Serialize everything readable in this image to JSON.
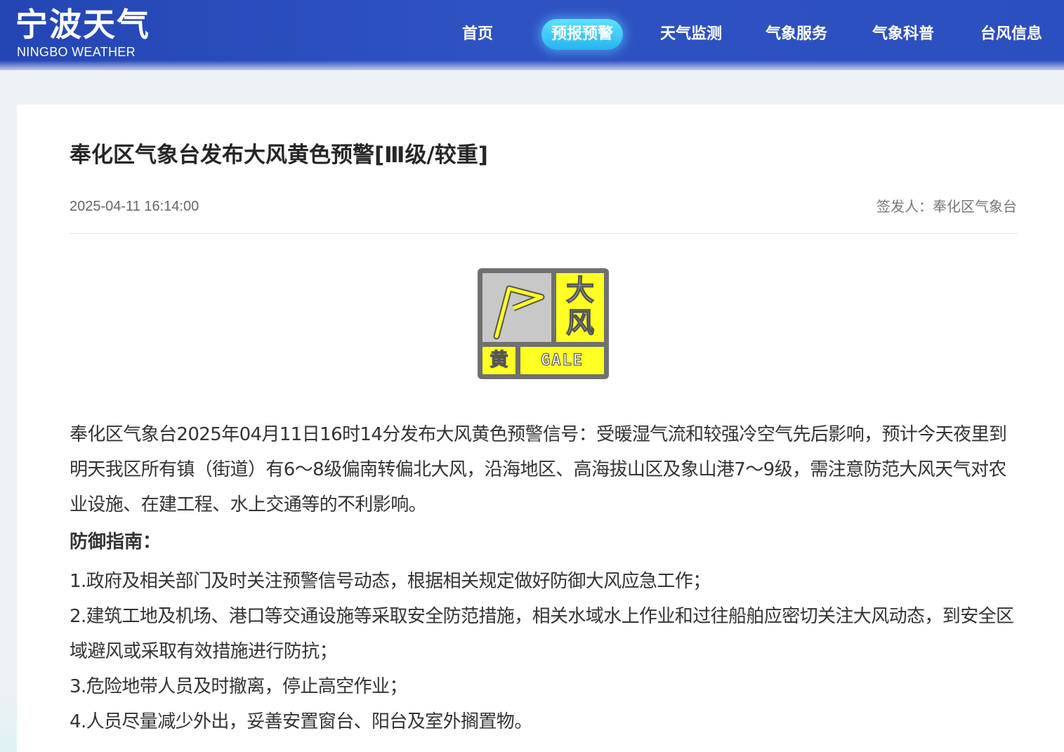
{
  "header": {
    "logo_cn": "宁波天气",
    "logo_en": "NINGBO WEATHER",
    "nav": [
      {
        "label": "首页",
        "active": false
      },
      {
        "label": "预报预警",
        "active": true
      },
      {
        "label": "天气监测",
        "active": false
      },
      {
        "label": "气象服务",
        "active": false
      },
      {
        "label": "气象科普",
        "active": false
      },
      {
        "label": "台风信息",
        "active": false
      }
    ],
    "accent_color": "#2c4fbf",
    "active_color": "#27b5f0"
  },
  "article": {
    "title": "奉化区气象台发布大风黄色预警[Ⅲ级/较重]",
    "date": "2025-04-11 16:14:00",
    "issuer": "签发人：奉化区气象台",
    "signal": {
      "icon": "gale-yellow-warning-icon",
      "char_top": "大",
      "char_bottom": "风",
      "level_char": "黄",
      "label_en": "GALE",
      "color": "#ffff22"
    },
    "body": "奉化区气象台2025年04月11日16时14分发布大风黄色预警信号：受暖湿气流和较强冷空气先后影响，预计今天夜里到明天我区所有镇（街道）有6～8级偏南转偏北大风，沿海地区、高海拔山区及象山港7～9级，需注意防范大风天气对农业设施、在建工程、水上交通等的不利影响。",
    "guide_heading": "防御指南：",
    "guide_items": [
      "1.政府及相关部门及时关注预警信号动态，根据相关规定做好防御大风应急工作；",
      "2.建筑工地及机场、港口等交通设施等采取安全防范措施，相关水域水上作业和过往船舶应密切关注大风动态，到安全区域避风或采取有效措施进行防抗；",
      "3.危险地带人员及时撤离，停止高空作业；",
      "4.人员尽量减少外出，妥善安置窗台、阳台及室外搁置物。"
    ]
  }
}
